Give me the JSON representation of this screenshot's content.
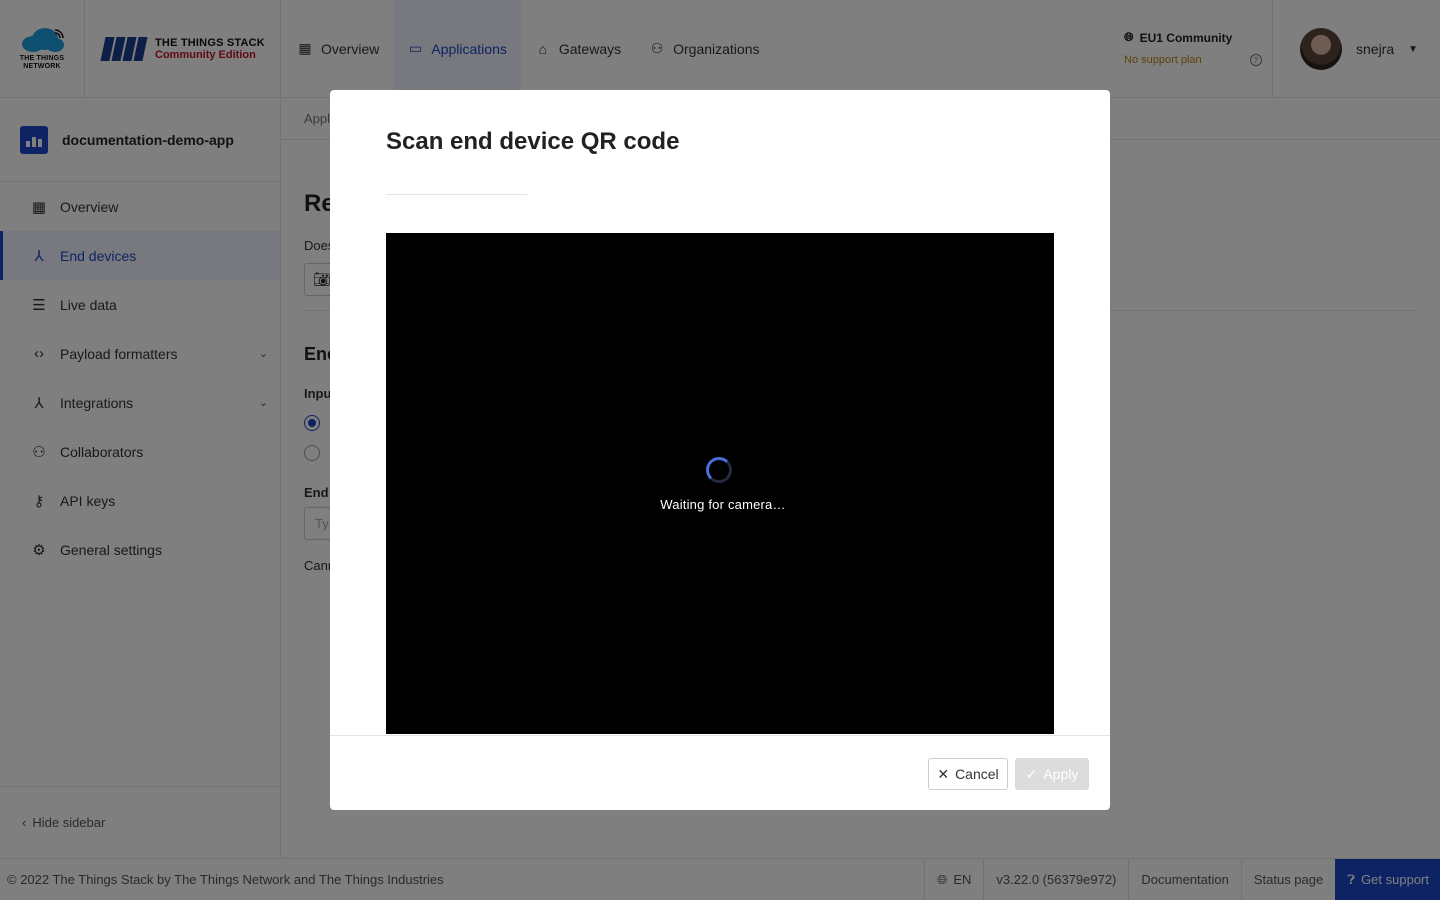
{
  "header": {
    "ttn_logo_text": [
      "THE THINGS",
      "NETWORK"
    ],
    "tts_title": "THE THINGS STACK",
    "tts_subtitle": "Community Edition",
    "nav": [
      {
        "label": "Overview",
        "icon": "dashboard-icon"
      },
      {
        "label": "Applications",
        "icon": "applications-icon",
        "active": true
      },
      {
        "label": "Gateways",
        "icon": "gateway-icon"
      },
      {
        "label": "Organizations",
        "icon": "organizations-icon"
      }
    ],
    "region": "EU1 Community",
    "support_plan": "No support plan",
    "user_name": "snejra"
  },
  "sidebar": {
    "app_name": "documentation-demo-app",
    "items": [
      {
        "label": "Overview",
        "icon": "dashboard-icon"
      },
      {
        "label": "End devices",
        "icon": "end-devices-icon",
        "active": true
      },
      {
        "label": "Live data",
        "icon": "live-data-icon"
      },
      {
        "label": "Payload formatters",
        "icon": "code-icon",
        "expandable": true
      },
      {
        "label": "Integrations",
        "icon": "integrations-icon",
        "expandable": true
      },
      {
        "label": "Collaborators",
        "icon": "collaborators-icon"
      },
      {
        "label": "API keys",
        "icon": "key-icon"
      },
      {
        "label": "General settings",
        "icon": "gear-icon"
      }
    ],
    "hide_label": "Hide sidebar"
  },
  "background": {
    "breadcrumb": "Appl",
    "title": "Re",
    "does_text": "Does",
    "section_title": "Enc",
    "input_label": "Inpu",
    "end_label": "End",
    "input_placeholder": "Ty",
    "cannot_text": "Cann"
  },
  "modal": {
    "title": "Scan end device QR code",
    "camera_status": "Waiting for camera…",
    "cancel_label": "Cancel",
    "apply_label": "Apply"
  },
  "footer": {
    "copyright": "© 2022 The Things Stack by The Things Network and The Things Industries",
    "language": "EN",
    "version": "v3.22.0 (56379e972)",
    "documentation": "Documentation",
    "status_page": "Status page",
    "get_support": "Get support"
  },
  "colors": {
    "accent": "#1a47c7",
    "brand_red": "#c0142b",
    "support_plan": "#b8860b"
  }
}
